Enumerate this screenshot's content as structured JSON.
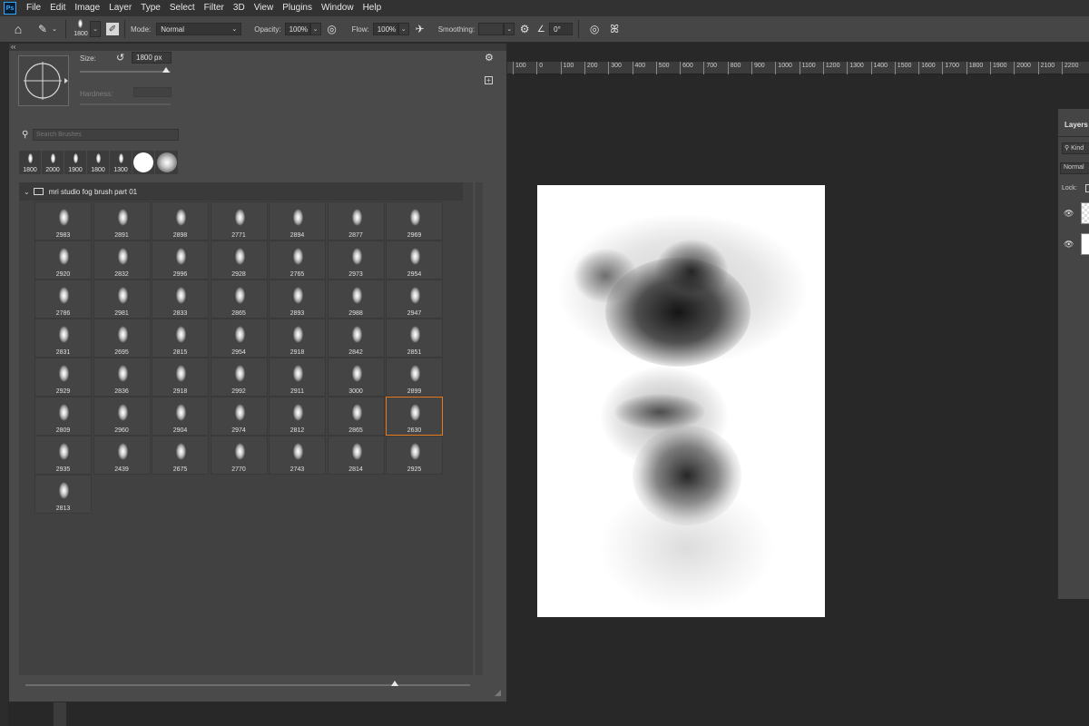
{
  "menubar": {
    "logo": "Ps",
    "items": [
      "File",
      "Edit",
      "Image",
      "Layer",
      "Type",
      "Select",
      "Filter",
      "3D",
      "View",
      "Plugins",
      "Window",
      "Help"
    ]
  },
  "options_bar": {
    "brush_size": "1800",
    "mode_label": "Mode:",
    "mode_value": "Normal",
    "opacity_label": "Opacity:",
    "opacity_value": "100%",
    "flow_label": "Flow:",
    "flow_value": "100%",
    "smoothing_label": "Smoothing:",
    "angle_value": "0°"
  },
  "brush_panel": {
    "size_label": "Size:",
    "size_value": "1800 px",
    "size_level": 0.95,
    "hardness_label": "Hardness:",
    "search_placeholder": "Search Brushes",
    "recent_brushes": [
      "1800",
      "2000",
      "1900",
      "1800",
      "1300"
    ],
    "group_title": "mri studio fog brush part 01",
    "brushes": [
      "2983",
      "2891",
      "2898",
      "2771",
      "2894",
      "2877",
      "2969",
      "2920",
      "2832",
      "2996",
      "2928",
      "2765",
      "2973",
      "2954",
      "2786",
      "2981",
      "2833",
      "2865",
      "2893",
      "2988",
      "2947",
      "2831",
      "2695",
      "2815",
      "2954",
      "2918",
      "2842",
      "2851",
      "2929",
      "2836",
      "2918",
      "2992",
      "2911",
      "3000",
      "2899",
      "2809",
      "2960",
      "2904",
      "2974",
      "2812",
      "2865",
      "2630",
      "2935",
      "2439",
      "2675",
      "2770",
      "2743",
      "2814",
      "2925",
      "2813"
    ],
    "selected_brush_index": 41,
    "preview_level": 0.83
  },
  "ruler": {
    "ticks": [
      "100",
      "0",
      "100",
      "200",
      "300",
      "400",
      "500",
      "600",
      "700",
      "800",
      "900",
      "1000",
      "1100",
      "1200",
      "1300",
      "1400",
      "1500",
      "1600",
      "1700",
      "1800",
      "1900",
      "2000",
      "2100",
      "2200"
    ]
  },
  "layers_panel": {
    "title": "Layers",
    "kind_value": "Kind",
    "blend_value": "Normal",
    "lock_label": "Lock:"
  },
  "colors": {
    "selection_accent": "#e87b1c",
    "ps_blue": "#31a8ff"
  }
}
